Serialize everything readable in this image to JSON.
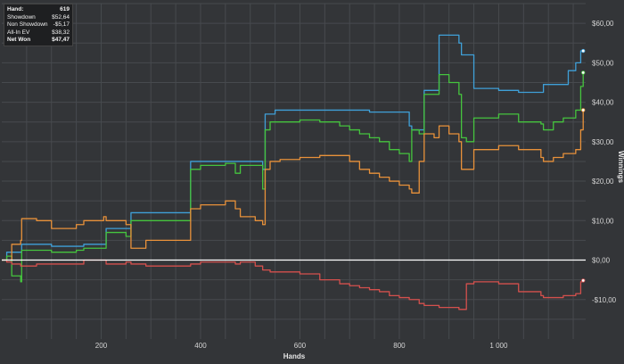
{
  "colors": {
    "background": "#333538",
    "grid": "#474a4e",
    "zero_line": "#ffffff",
    "net_won": "#3fa0d8",
    "showdown": "#45c43e",
    "all_in_ev": "#e8913a",
    "non_showdown": "#d4504d"
  },
  "stats_box": {
    "rows": [
      {
        "label": "Hand:",
        "value": "619"
      },
      {
        "label": "Showdown",
        "value": "$52,64"
      },
      {
        "label": "Non Showdown",
        "value": "-$5,17"
      },
      {
        "label": "All-In EV",
        "value": "$38,32"
      },
      {
        "label": "Net Won",
        "value": "$47,47"
      }
    ]
  },
  "chart_data": {
    "type": "line",
    "xlabel": "Hands",
    "ylabel": "Winnings",
    "xlim": [
      0,
      1175
    ],
    "ylim": [
      -20,
      65
    ],
    "x_ticks": [
      200,
      400,
      600,
      800,
      1000
    ],
    "x_tick_labels": [
      "200",
      "400",
      "600",
      "800",
      "1 000"
    ],
    "y_ticks": [
      -10,
      0,
      10,
      20,
      30,
      40,
      50,
      60
    ],
    "y_tick_labels": [
      "-$10,00",
      "$0,00",
      "$10,00",
      "$20,00",
      "$30,00",
      "$40,00",
      "$50,00",
      "$60,00"
    ],
    "y_axis_position": "right",
    "grid": true,
    "series": [
      {
        "color": "#3fa0d8",
        "x": [
          0,
          10,
          20,
          38,
          40,
          70,
          100,
          150,
          165,
          205,
          210,
          250,
          260,
          290,
          370,
          380,
          450,
          460,
          510,
          525,
          530,
          550,
          600,
          680,
          700,
          740,
          760,
          820,
          825,
          840,
          850,
          870,
          880,
          920,
          925,
          950,
          1000,
          1040,
          1085,
          1090,
          1110,
          1130,
          1140,
          1155,
          1165,
          1170
        ],
        "y": [
          0,
          2,
          2,
          2,
          4,
          4,
          3.5,
          3.5,
          4,
          4,
          8,
          8,
          12,
          12,
          12,
          25,
          25,
          25,
          25,
          23,
          37,
          38,
          38,
          38,
          38,
          37.5,
          37.5,
          34,
          33,
          33,
          43,
          43,
          57,
          55,
          52,
          43.5,
          43,
          42.5,
          42.5,
          44.5,
          44.5,
          44.5,
          48,
          50,
          53,
          53
        ]
      },
      {
        "color": "#45c43e",
        "x": [
          0,
          10,
          20,
          38,
          40,
          70,
          100,
          150,
          165,
          205,
          210,
          250,
          260,
          290,
          370,
          380,
          400,
          430,
          450,
          470,
          480,
          510,
          525,
          530,
          540,
          560,
          600,
          640,
          680,
          700,
          720,
          740,
          760,
          780,
          800,
          820,
          825,
          840,
          850,
          870,
          880,
          900,
          920,
          925,
          935,
          950,
          1000,
          1040,
          1085,
          1090,
          1110,
          1130,
          1140,
          1155,
          1165,
          1170
        ],
        "y": [
          0,
          1,
          -4,
          -5.5,
          2.5,
          2.5,
          2,
          2.5,
          3,
          3,
          7,
          6,
          10,
          10,
          10,
          23,
          24,
          24,
          24.5,
          22,
          24,
          24,
          18,
          33,
          35,
          35,
          35.5,
          35,
          34,
          33,
          32,
          31,
          30,
          28,
          27,
          25,
          33,
          32,
          42,
          42,
          47,
          45,
          42,
          31,
          30,
          36,
          37,
          35,
          34.5,
          33,
          35,
          36,
          36,
          38,
          44,
          47.5
        ]
      },
      {
        "color": "#e8913a",
        "x": [
          0,
          10,
          20,
          38,
          40,
          70,
          100,
          150,
          165,
          205,
          210,
          250,
          260,
          290,
          370,
          380,
          400,
          430,
          450,
          470,
          480,
          510,
          525,
          530,
          540,
          560,
          600,
          640,
          680,
          700,
          720,
          740,
          760,
          780,
          800,
          820,
          825,
          840,
          850,
          870,
          880,
          900,
          920,
          925,
          935,
          950,
          1000,
          1040,
          1085,
          1090,
          1110,
          1130,
          1140,
          1155,
          1165,
          1170
        ],
        "y": [
          0,
          0,
          4,
          5,
          10.5,
          10,
          8,
          9,
          10,
          11,
          10,
          9,
          3,
          5,
          5,
          13,
          14,
          14,
          15,
          13,
          11,
          10,
          9,
          23,
          25,
          25.5,
          26,
          26.5,
          26.5,
          25,
          23,
          22,
          21,
          20,
          19,
          18,
          17,
          25,
          32,
          31,
          34,
          32,
          30,
          23,
          23,
          28,
          29,
          28,
          26,
          25,
          26,
          27,
          27,
          28,
          33,
          38
        ]
      },
      {
        "color": "#d4504d",
        "x": [
          0,
          10,
          20,
          38,
          40,
          70,
          100,
          150,
          165,
          205,
          210,
          250,
          260,
          290,
          370,
          380,
          400,
          430,
          450,
          470,
          480,
          510,
          525,
          530,
          540,
          560,
          600,
          640,
          680,
          700,
          720,
          740,
          760,
          780,
          800,
          820,
          825,
          840,
          850,
          870,
          880,
          900,
          920,
          925,
          935,
          950,
          1000,
          1040,
          1085,
          1090,
          1110,
          1130,
          1140,
          1155,
          1165,
          1170
        ],
        "y": [
          0,
          -0.5,
          -1,
          -1.5,
          -1.5,
          -1,
          -1,
          -1,
          0,
          0,
          -1,
          -0.5,
          -1,
          -1.5,
          -1.5,
          -1,
          -0.5,
          -0.5,
          -0.5,
          -1,
          -0.5,
          -1.5,
          -2.5,
          -2.5,
          -3,
          -3,
          -3.5,
          -5,
          -6,
          -6.5,
          -7,
          -7.5,
          -8,
          -9,
          -9.5,
          -10,
          -10,
          -11,
          -11.5,
          -11.5,
          -12,
          -12,
          -12.5,
          -12.5,
          -6,
          -5.5,
          -6,
          -8,
          -9,
          -9.5,
          -9.5,
          -9,
          -9,
          -8.5,
          -5.5,
          -5.17
        ]
      }
    ]
  }
}
